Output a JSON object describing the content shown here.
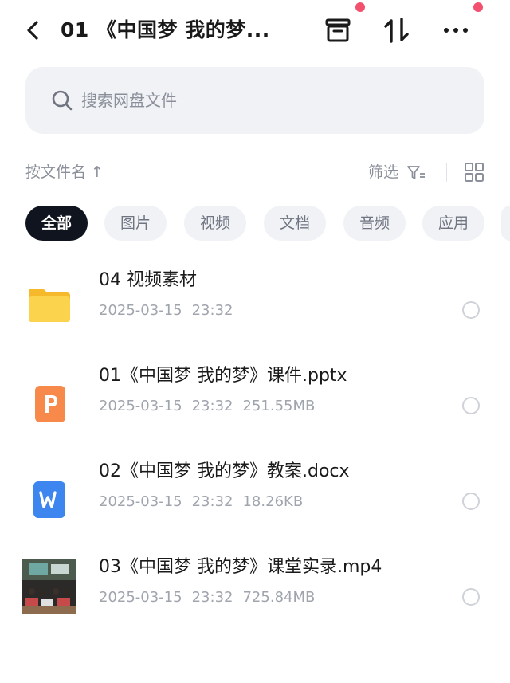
{
  "header": {
    "title": "01 《中国梦 我的梦...",
    "back_icon": "chevron-left-icon",
    "actions": [
      {
        "icon": "archive-icon",
        "badge": true
      },
      {
        "icon": "sort-arrows-icon",
        "badge": false
      },
      {
        "icon": "more-icon",
        "badge": true
      }
    ],
    "badge_color": "#f2506e"
  },
  "search": {
    "placeholder": "搜索网盘文件"
  },
  "sort": {
    "label": "按文件名 ↑",
    "filter_label": "筛选"
  },
  "chips": [
    "全部",
    "图片",
    "视频",
    "文档",
    "音频",
    "应用"
  ],
  "active_chip": "全部",
  "files": [
    {
      "name": "04 视频素材",
      "date": "2025-03-15",
      "time": "23:32",
      "size": "",
      "type": "folder"
    },
    {
      "name": "01《中国梦 我的梦》课件.pptx",
      "date": "2025-03-15",
      "time": "23:32",
      "size": "251.55MB",
      "type": "pptx"
    },
    {
      "name": "02《中国梦 我的梦》教案.docx",
      "date": "2025-03-15",
      "time": "23:32",
      "size": "18.26KB",
      "type": "docx"
    },
    {
      "name": "03《中国梦 我的梦》课堂实录.mp4",
      "date": "2025-03-15",
      "time": "23:32",
      "size": "725.84MB",
      "type": "video"
    }
  ],
  "colors": {
    "folder": "#fcc93a",
    "pptx": "#f7894a",
    "docx": "#3d86f0",
    "active_chip_bg": "#0f141e"
  }
}
